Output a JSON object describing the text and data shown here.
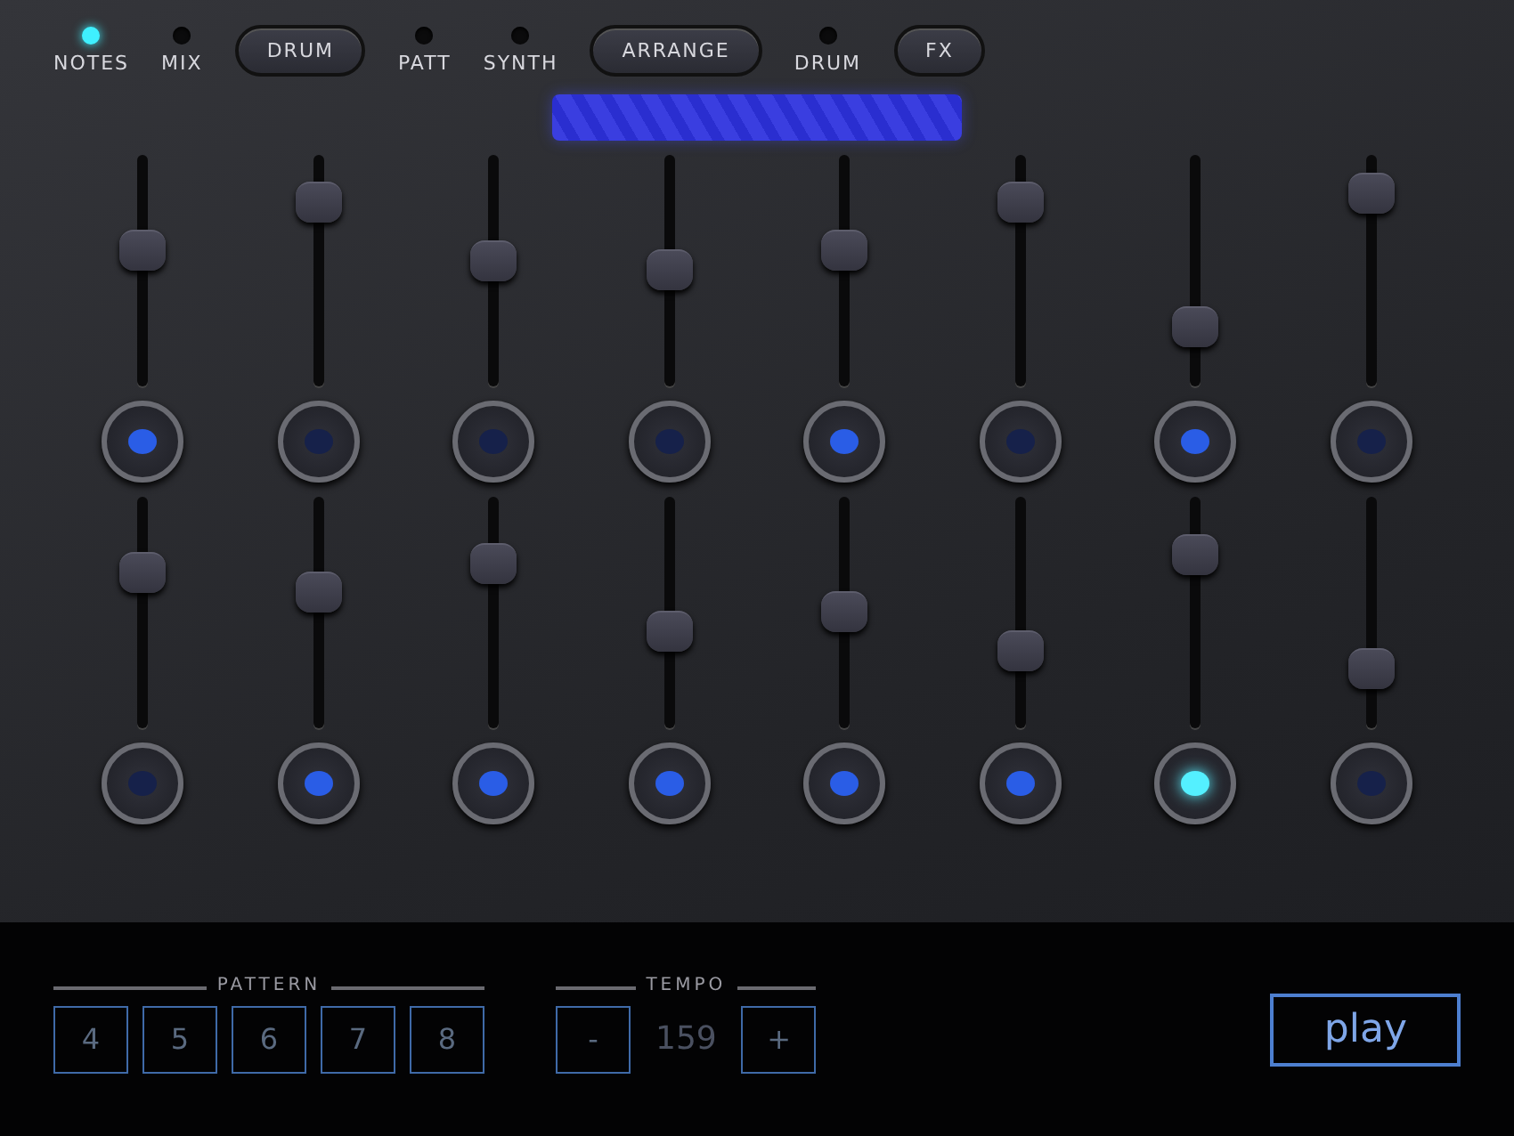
{
  "mode_bar": [
    {
      "kind": "indicator",
      "label": "NOTES",
      "on": true
    },
    {
      "kind": "indicator",
      "label": "MIX",
      "on": false
    },
    {
      "kind": "button",
      "label": "DRUM"
    },
    {
      "kind": "indicator",
      "label": "PATT",
      "on": false
    },
    {
      "kind": "indicator",
      "label": "SYNTH",
      "on": false
    },
    {
      "kind": "button",
      "label": "ARRANGE"
    },
    {
      "kind": "indicator",
      "label": "DRUM",
      "on": false
    },
    {
      "kind": "button",
      "label": "FX"
    }
  ],
  "mixer": [
    {
      "channels": [
        {
          "level": 0.6,
          "on": true,
          "selected": false
        },
        {
          "level": 0.85,
          "on": false,
          "selected": false
        },
        {
          "level": 0.55,
          "on": false,
          "selected": false
        },
        {
          "level": 0.5,
          "on": false,
          "selected": false
        },
        {
          "level": 0.6,
          "on": true,
          "selected": false
        },
        {
          "level": 0.85,
          "on": false,
          "selected": false
        },
        {
          "level": 0.2,
          "on": true,
          "selected": false
        },
        {
          "level": 0.9,
          "on": false,
          "selected": false
        }
      ]
    },
    {
      "channels": [
        {
          "level": 0.7,
          "on": false,
          "selected": false
        },
        {
          "level": 0.6,
          "on": true,
          "selected": false
        },
        {
          "level": 0.75,
          "on": true,
          "selected": false
        },
        {
          "level": 0.4,
          "on": true,
          "selected": false
        },
        {
          "level": 0.5,
          "on": true,
          "selected": false
        },
        {
          "level": 0.3,
          "on": true,
          "selected": false
        },
        {
          "level": 0.8,
          "on": true,
          "selected": true
        },
        {
          "level": 0.2,
          "on": false,
          "selected": false
        }
      ]
    }
  ],
  "pattern": {
    "title": "PATTERN",
    "slots": [
      "4",
      "5",
      "6",
      "7",
      "8"
    ]
  },
  "tempo": {
    "title": "TEMPO",
    "decrease": "-",
    "value": "159",
    "increase": "+"
  },
  "transport": {
    "play": "play"
  }
}
